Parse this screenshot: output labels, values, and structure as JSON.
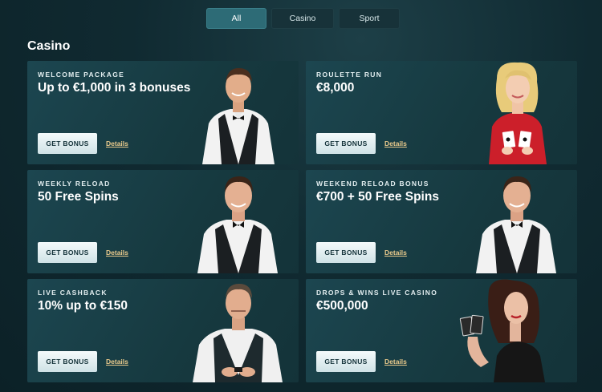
{
  "tabs": [
    {
      "label": "All",
      "active": true
    },
    {
      "label": "Casino",
      "active": false
    },
    {
      "label": "Sport",
      "active": false
    }
  ],
  "section_title": "Casino",
  "colors": {
    "accent": "#2d6b76",
    "details_link": "#e8c98b",
    "card_bg": "#1c4650"
  },
  "cards": [
    {
      "kicker": "WELCOME PACKAGE",
      "headline": "Up to €1,000 in 3 bonuses",
      "button": "GET BONUS",
      "link": "Details",
      "image": "male-dealer-vest-smiling"
    },
    {
      "kicker": "ROULETTE RUN",
      "headline": "€8,000",
      "button": "GET BONUS",
      "link": "Details",
      "image": "female-dealer-red-dress-holding-cards"
    },
    {
      "kicker": "WEEKLY RELOAD",
      "headline": "50 Free Spins",
      "button": "GET BONUS",
      "link": "Details",
      "image": "male-dealer-bowtie"
    },
    {
      "kicker": "WEEKEND RELOAD BONUS",
      "headline": "€700 + 50 Free Spins",
      "button": "GET BONUS",
      "link": "Details",
      "image": "male-dealer-bowtie"
    },
    {
      "kicker": "LIVE CASHBACK",
      "headline": "10% up to €150",
      "button": "GET BONUS",
      "link": "Details",
      "image": "male-dealer-shuffling"
    },
    {
      "kicker": "DROPS & WINS LIVE CASINO",
      "headline": "€500,000",
      "button": "GET BONUS",
      "link": "Details",
      "image": "female-dealer-black-dress-holding-cards"
    }
  ]
}
